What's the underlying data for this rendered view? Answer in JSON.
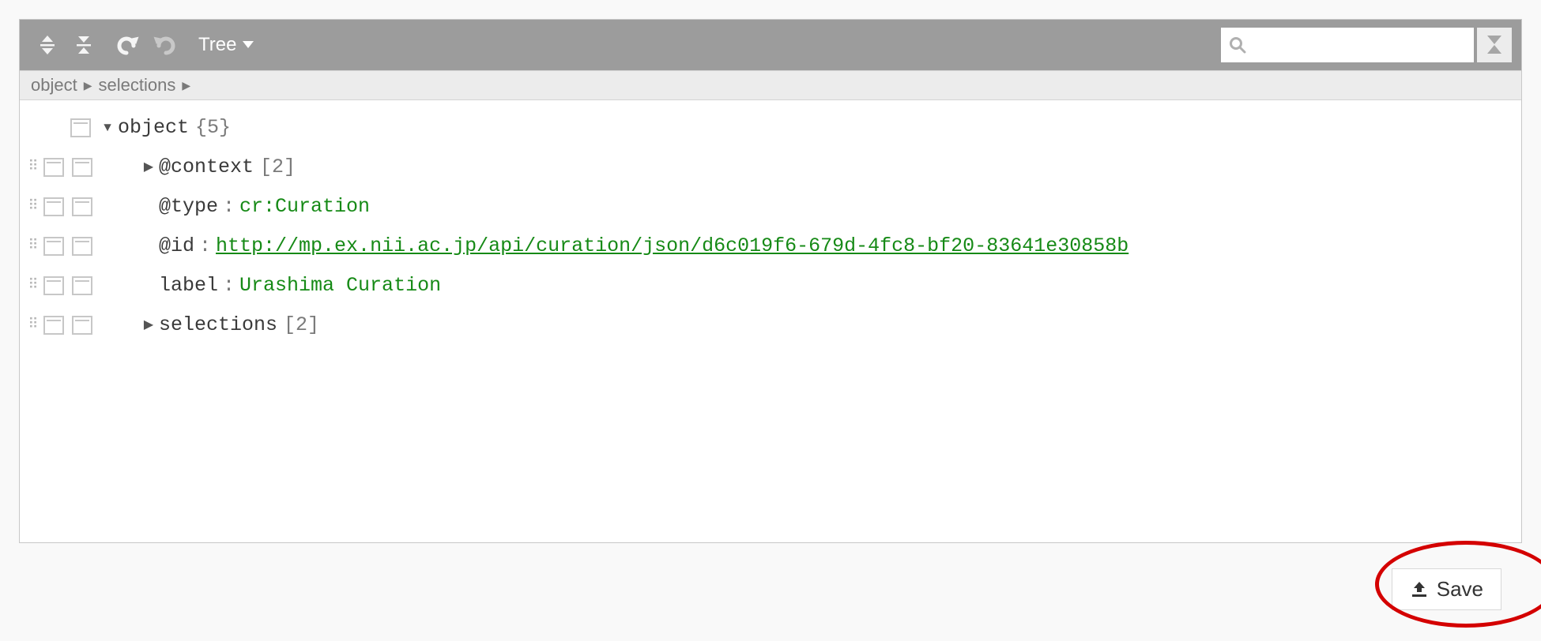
{
  "toolbar": {
    "mode_label": "Tree"
  },
  "search": {
    "placeholder": ""
  },
  "breadcrumb": {
    "items": [
      "object",
      "selections"
    ]
  },
  "tree": {
    "root_label": "object",
    "root_count": "{5}",
    "rows": [
      {
        "key": "@context",
        "count": "[2]",
        "type": "collapsed"
      },
      {
        "key": "@type",
        "value": "cr:Curation",
        "type": "leaf"
      },
      {
        "key": "@id",
        "value": "http://mp.ex.nii.ac.jp/api/curation/json/d6c019f6-679d-4fc8-bf20-83641e30858b",
        "type": "link"
      },
      {
        "key": "label",
        "value": "Urashima Curation",
        "type": "leaf"
      },
      {
        "key": "selections",
        "count": "[2]",
        "type": "collapsed"
      }
    ]
  },
  "save_label": "Save"
}
